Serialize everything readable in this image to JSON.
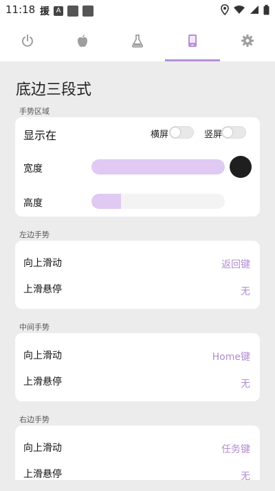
{
  "status_bar": {
    "time": "11:18",
    "icons_left": [
      "yuan-icon",
      "a-icon",
      "square-icon",
      "square-icon"
    ],
    "yuan_glyph": "援",
    "a_glyph": "A",
    "icons_right": [
      "location-icon",
      "wifi-icon",
      "signal-icon",
      "battery-icon"
    ]
  },
  "tabs": [
    {
      "name": "power-icon"
    },
    {
      "name": "apple-icon"
    },
    {
      "name": "flask-icon"
    },
    {
      "name": "phone-icon",
      "active": true
    },
    {
      "name": "gear-icon"
    }
  ],
  "accent_color": "#b790d4",
  "page_title": "底边三段式",
  "gesture_area": {
    "section_label": "手势区域",
    "display_label": "显示在",
    "landscape_label": "横屏",
    "portrait_label": "竖屏",
    "landscape_on": false,
    "portrait_on": false,
    "width_label": "宽度",
    "width_fraction": 1.0,
    "height_label": "高度",
    "height_fraction": 0.22,
    "color": "#1f1f1f"
  },
  "left_gesture": {
    "section_label": "左边手势",
    "swipe_up_label": "向上滑动",
    "swipe_up_value": "返回键",
    "hover_label": "上滑悬停",
    "hover_value": "无"
  },
  "middle_gesture": {
    "section_label": "中间手势",
    "swipe_up_label": "向上滑动",
    "swipe_up_value": "Home键",
    "hover_label": "上滑悬停",
    "hover_value": "无"
  },
  "right_gesture": {
    "section_label": "右边手势",
    "swipe_up_label": "向上滑动",
    "swipe_up_value": "任务键",
    "hover_label": "上滑悬停",
    "hover_value": "无"
  }
}
